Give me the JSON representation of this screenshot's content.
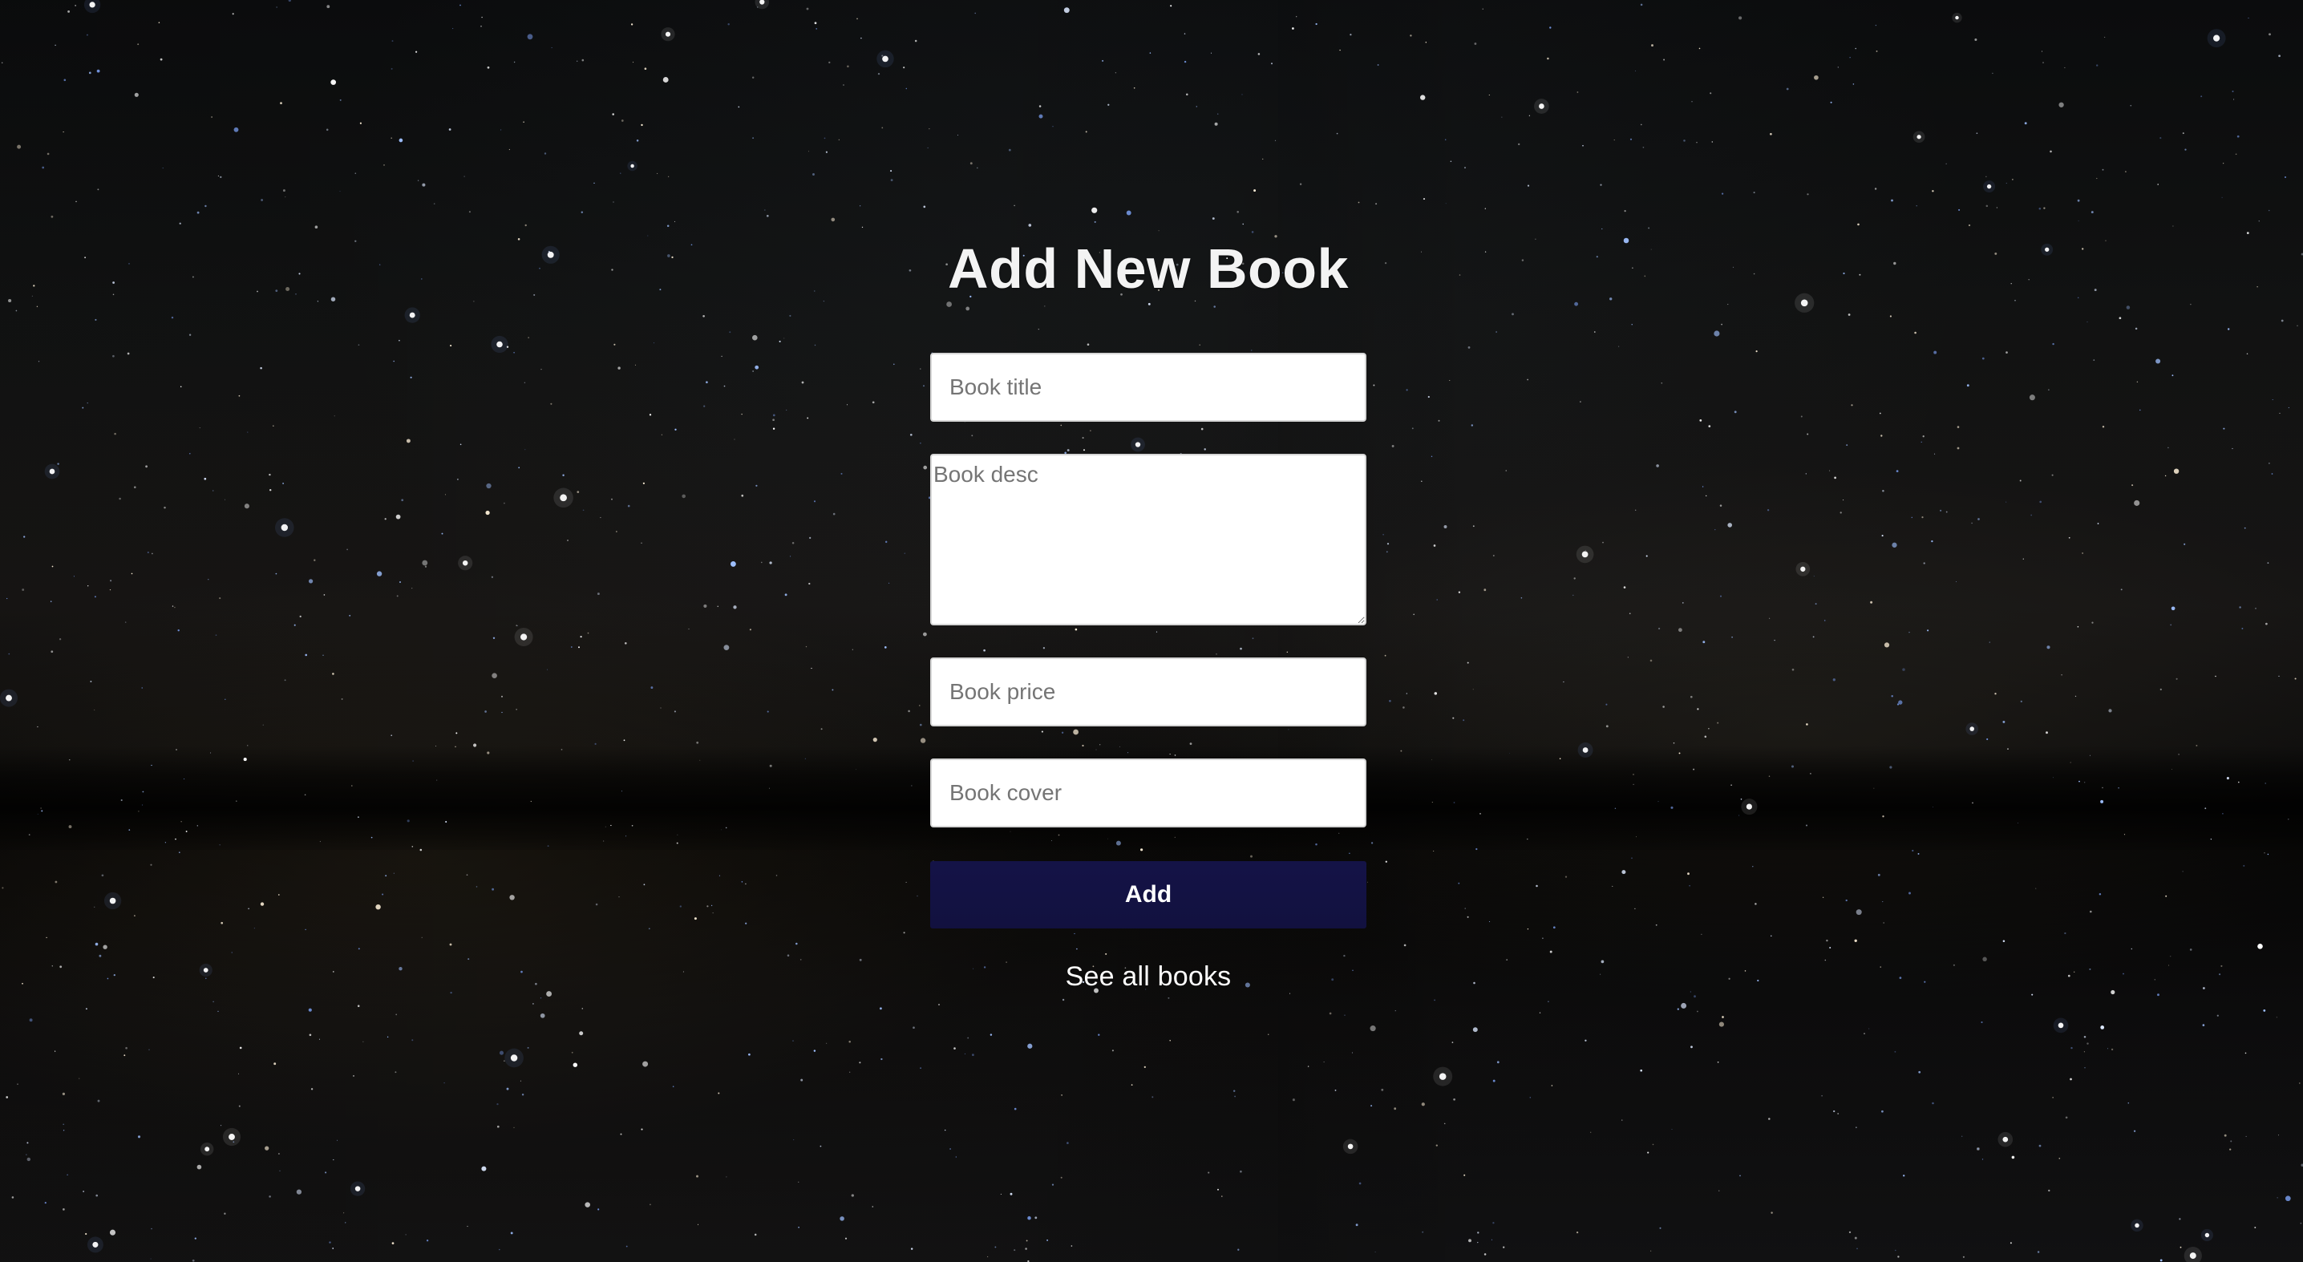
{
  "page": {
    "title": "Add New Book",
    "colors": {
      "background": "#050505",
      "title": "#f3f3f3",
      "field_background": "#ffffff",
      "field_border": "#d6d6d6",
      "button_background": "#141347",
      "button_text": "#ffffff",
      "link_text": "#ffffff"
    }
  },
  "form": {
    "title_placeholder": "Book title",
    "description_placeholder": "Book desc",
    "price_placeholder": "Book price",
    "cover_placeholder": "Book cover",
    "submit_label": "Add",
    "see_all_label": "See all books"
  }
}
